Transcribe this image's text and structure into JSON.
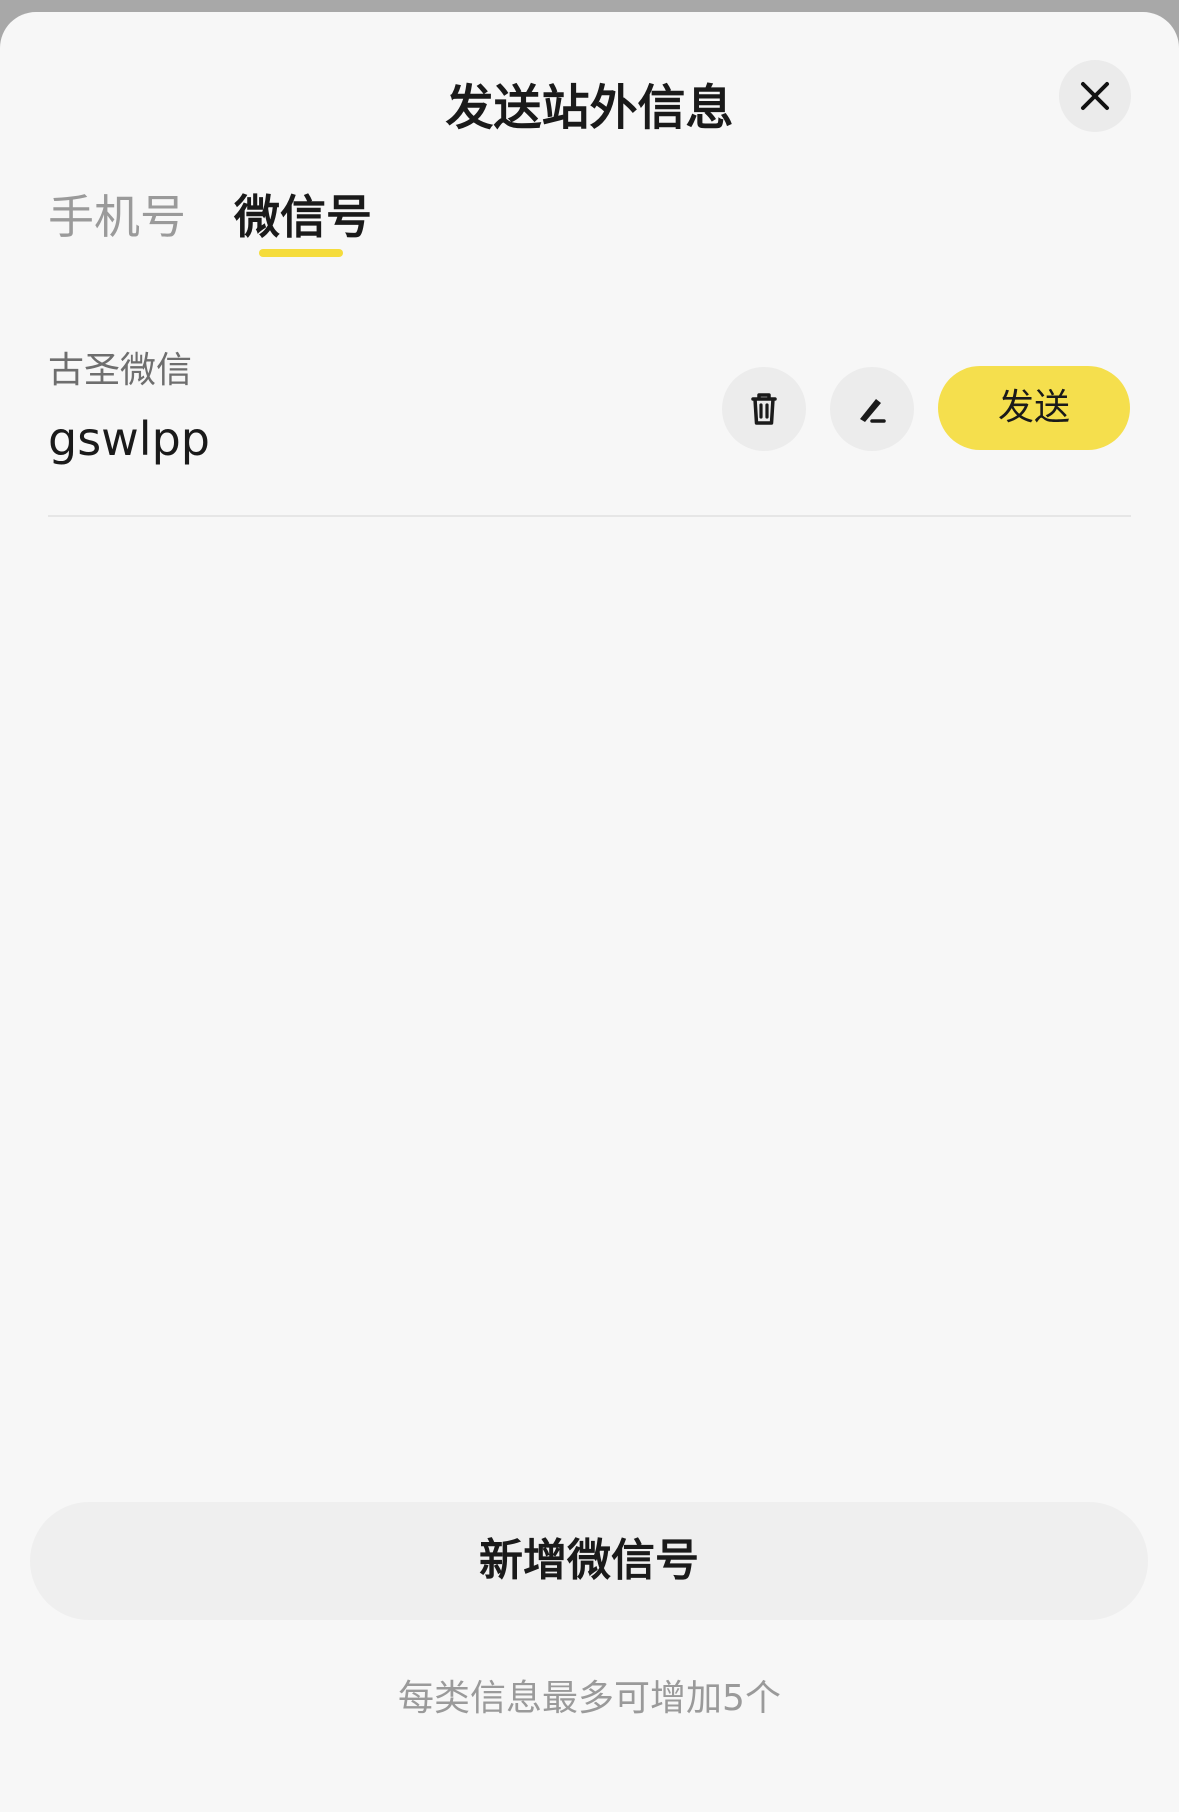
{
  "sheet": {
    "title": "发送站外信息",
    "close_icon": "close-icon"
  },
  "tabs": [
    {
      "label": "手机号",
      "active": false
    },
    {
      "label": "微信号",
      "active": true
    }
  ],
  "accent_color": "#f5df4d",
  "entries": [
    {
      "label": "古圣微信",
      "value": "gswlpp",
      "delete_icon": "trash-icon",
      "edit_icon": "pen-icon",
      "send_label": "发送"
    }
  ],
  "add_button_label": "新增微信号",
  "limit_note": "每类信息最多可增加5个"
}
